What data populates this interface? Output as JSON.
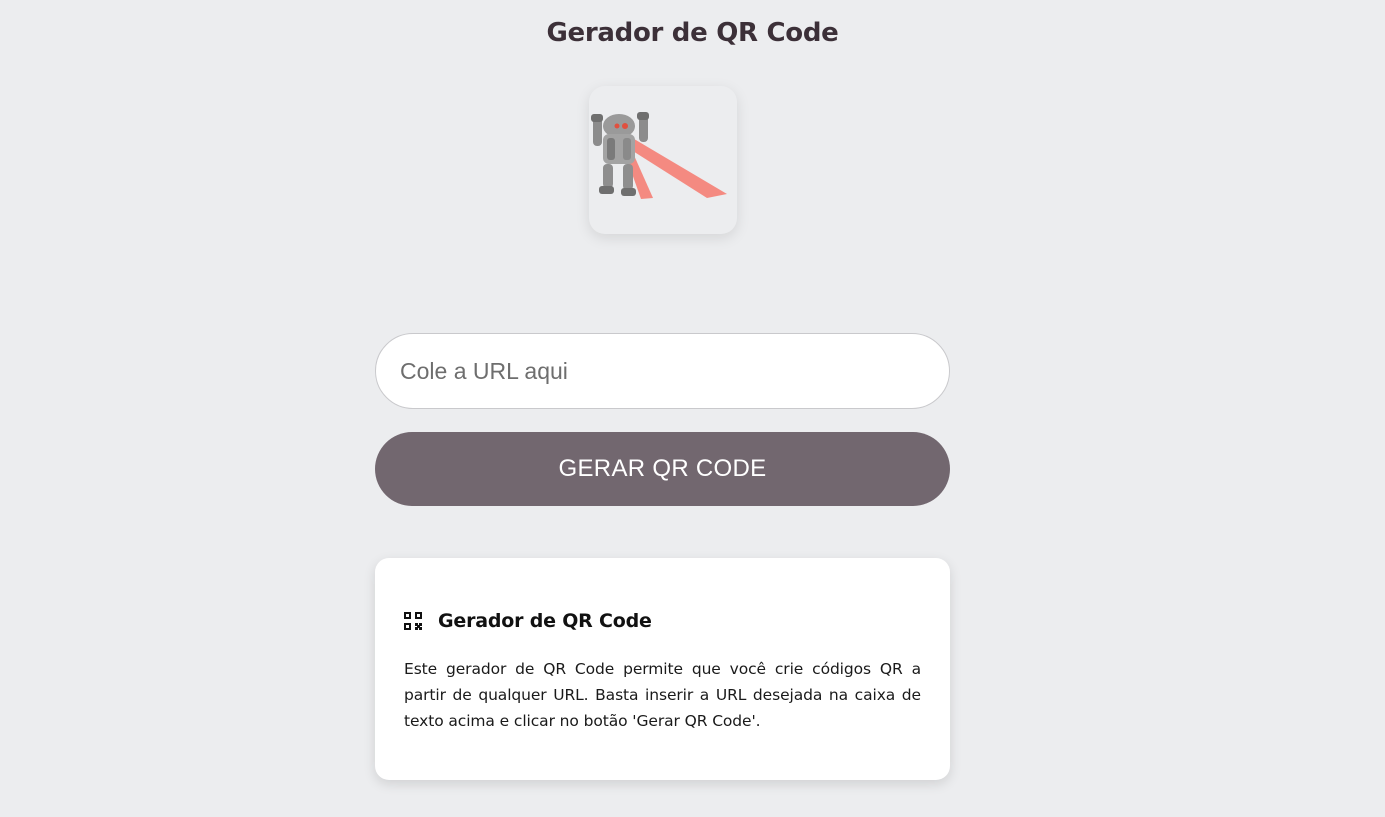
{
  "header": {
    "title": "Gerador de QR Code"
  },
  "logo": {
    "icon": "robot-with-laser-icon",
    "laser_color": "#f4857a"
  },
  "form": {
    "url_placeholder": "Cole a URL aqui",
    "url_value": "",
    "generate_label": "GERAR QR CODE"
  },
  "info_card": {
    "icon": "qr-code-icon",
    "title": "Gerador de QR Code",
    "text": "Este gerador de QR Code permite que você crie códigos QR a partir de qualquer URL. Basta inserir a URL desejada na caixa de texto acima e clicar no botão 'Gerar QR Code'."
  },
  "colors": {
    "background": "#ecedef",
    "button": "#72676f",
    "title_text": "#3c3038",
    "card": "#ffffff"
  }
}
